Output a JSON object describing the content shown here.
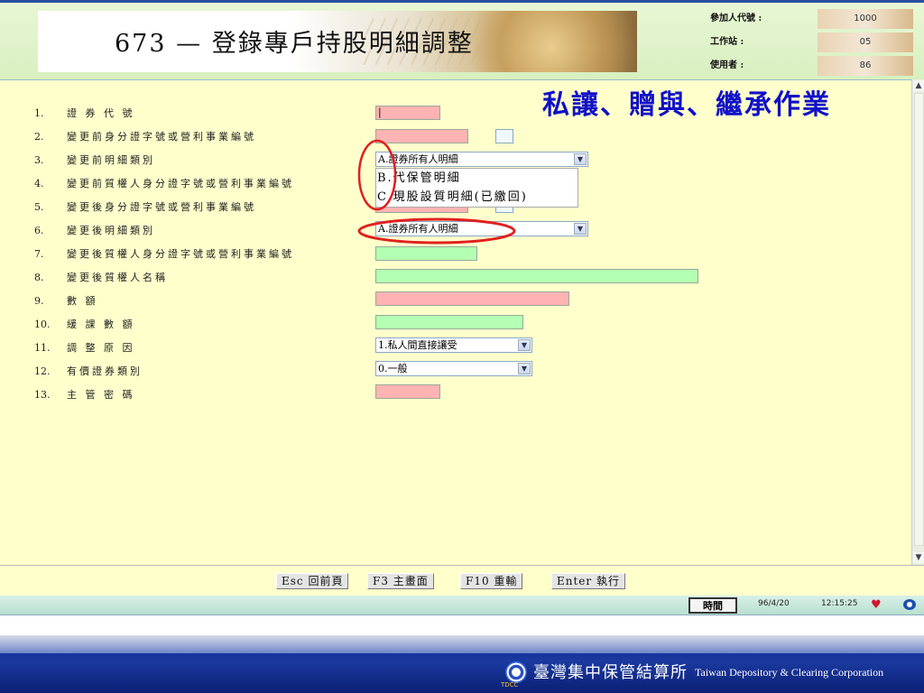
{
  "header": {
    "title": "673  —  登錄專戶持股明細調整",
    "info": [
      {
        "label": "參加人代號 :",
        "value": "1000"
      },
      {
        "label": "工作站     :",
        "value": "05"
      },
      {
        "label": "使用者     :",
        "value": "86"
      }
    ]
  },
  "overlay_title": "私讓、贈與、繼承作業",
  "form": {
    "rows": [
      {
        "num": "1.",
        "label": "證 券 代 號"
      },
      {
        "num": "2.",
        "label": "變更前身分證字號或營利事業編號"
      },
      {
        "num": "3.",
        "label": "變更前明細類別"
      },
      {
        "num": "4.",
        "label": "變更前質權人身分證字號或營利事業編號"
      },
      {
        "num": "5.",
        "label": "變更後身分證字號或營利事業編號"
      },
      {
        "num": "6.",
        "label": "變更後明細類別"
      },
      {
        "num": "7.",
        "label": "變更後質權人身分證字號或營利事業編號"
      },
      {
        "num": "8.",
        "label": "變更後質權人名稱"
      },
      {
        "num": "9.",
        "label": "數            額"
      },
      {
        "num": "10.",
        "label": "緩 課 數 額"
      },
      {
        "num": "11.",
        "label": "調 整 原 因"
      },
      {
        "num": "12.",
        "label": "有價證券類別"
      },
      {
        "num": "13.",
        "label": "主 管 密 碼"
      }
    ],
    "fields": {
      "stock_code": "|",
      "before_category": "A.證券所有人明細",
      "after_category": "A.證券所有人明細",
      "adjust_reason": "1.私人間直接讓受",
      "security_type": "0.一般"
    },
    "dropdown_options": [
      "B.代保管明細",
      "C.現股設質明細(已繳回)"
    ]
  },
  "buttons": [
    {
      "label": "Esc 回前頁"
    },
    {
      "label": "F3 主畫面"
    },
    {
      "label": "F10 重輸"
    },
    {
      "label": "Enter 執行"
    }
  ],
  "status": {
    "time_button": "時間",
    "date": "96/4/20",
    "time": "12:15:25"
  },
  "footer": {
    "logo_text": "TDCC",
    "company_cn": "臺灣集中保管結算所",
    "company_en": "Taiwan Depository & Clearing Corporation"
  },
  "colors": {
    "required_field": "#ffb3b3",
    "optional_field": "#b3ffb3",
    "form_background": "#ffffcc",
    "annotation_red": "#e02020",
    "overlay_blue": "#1010c8"
  }
}
